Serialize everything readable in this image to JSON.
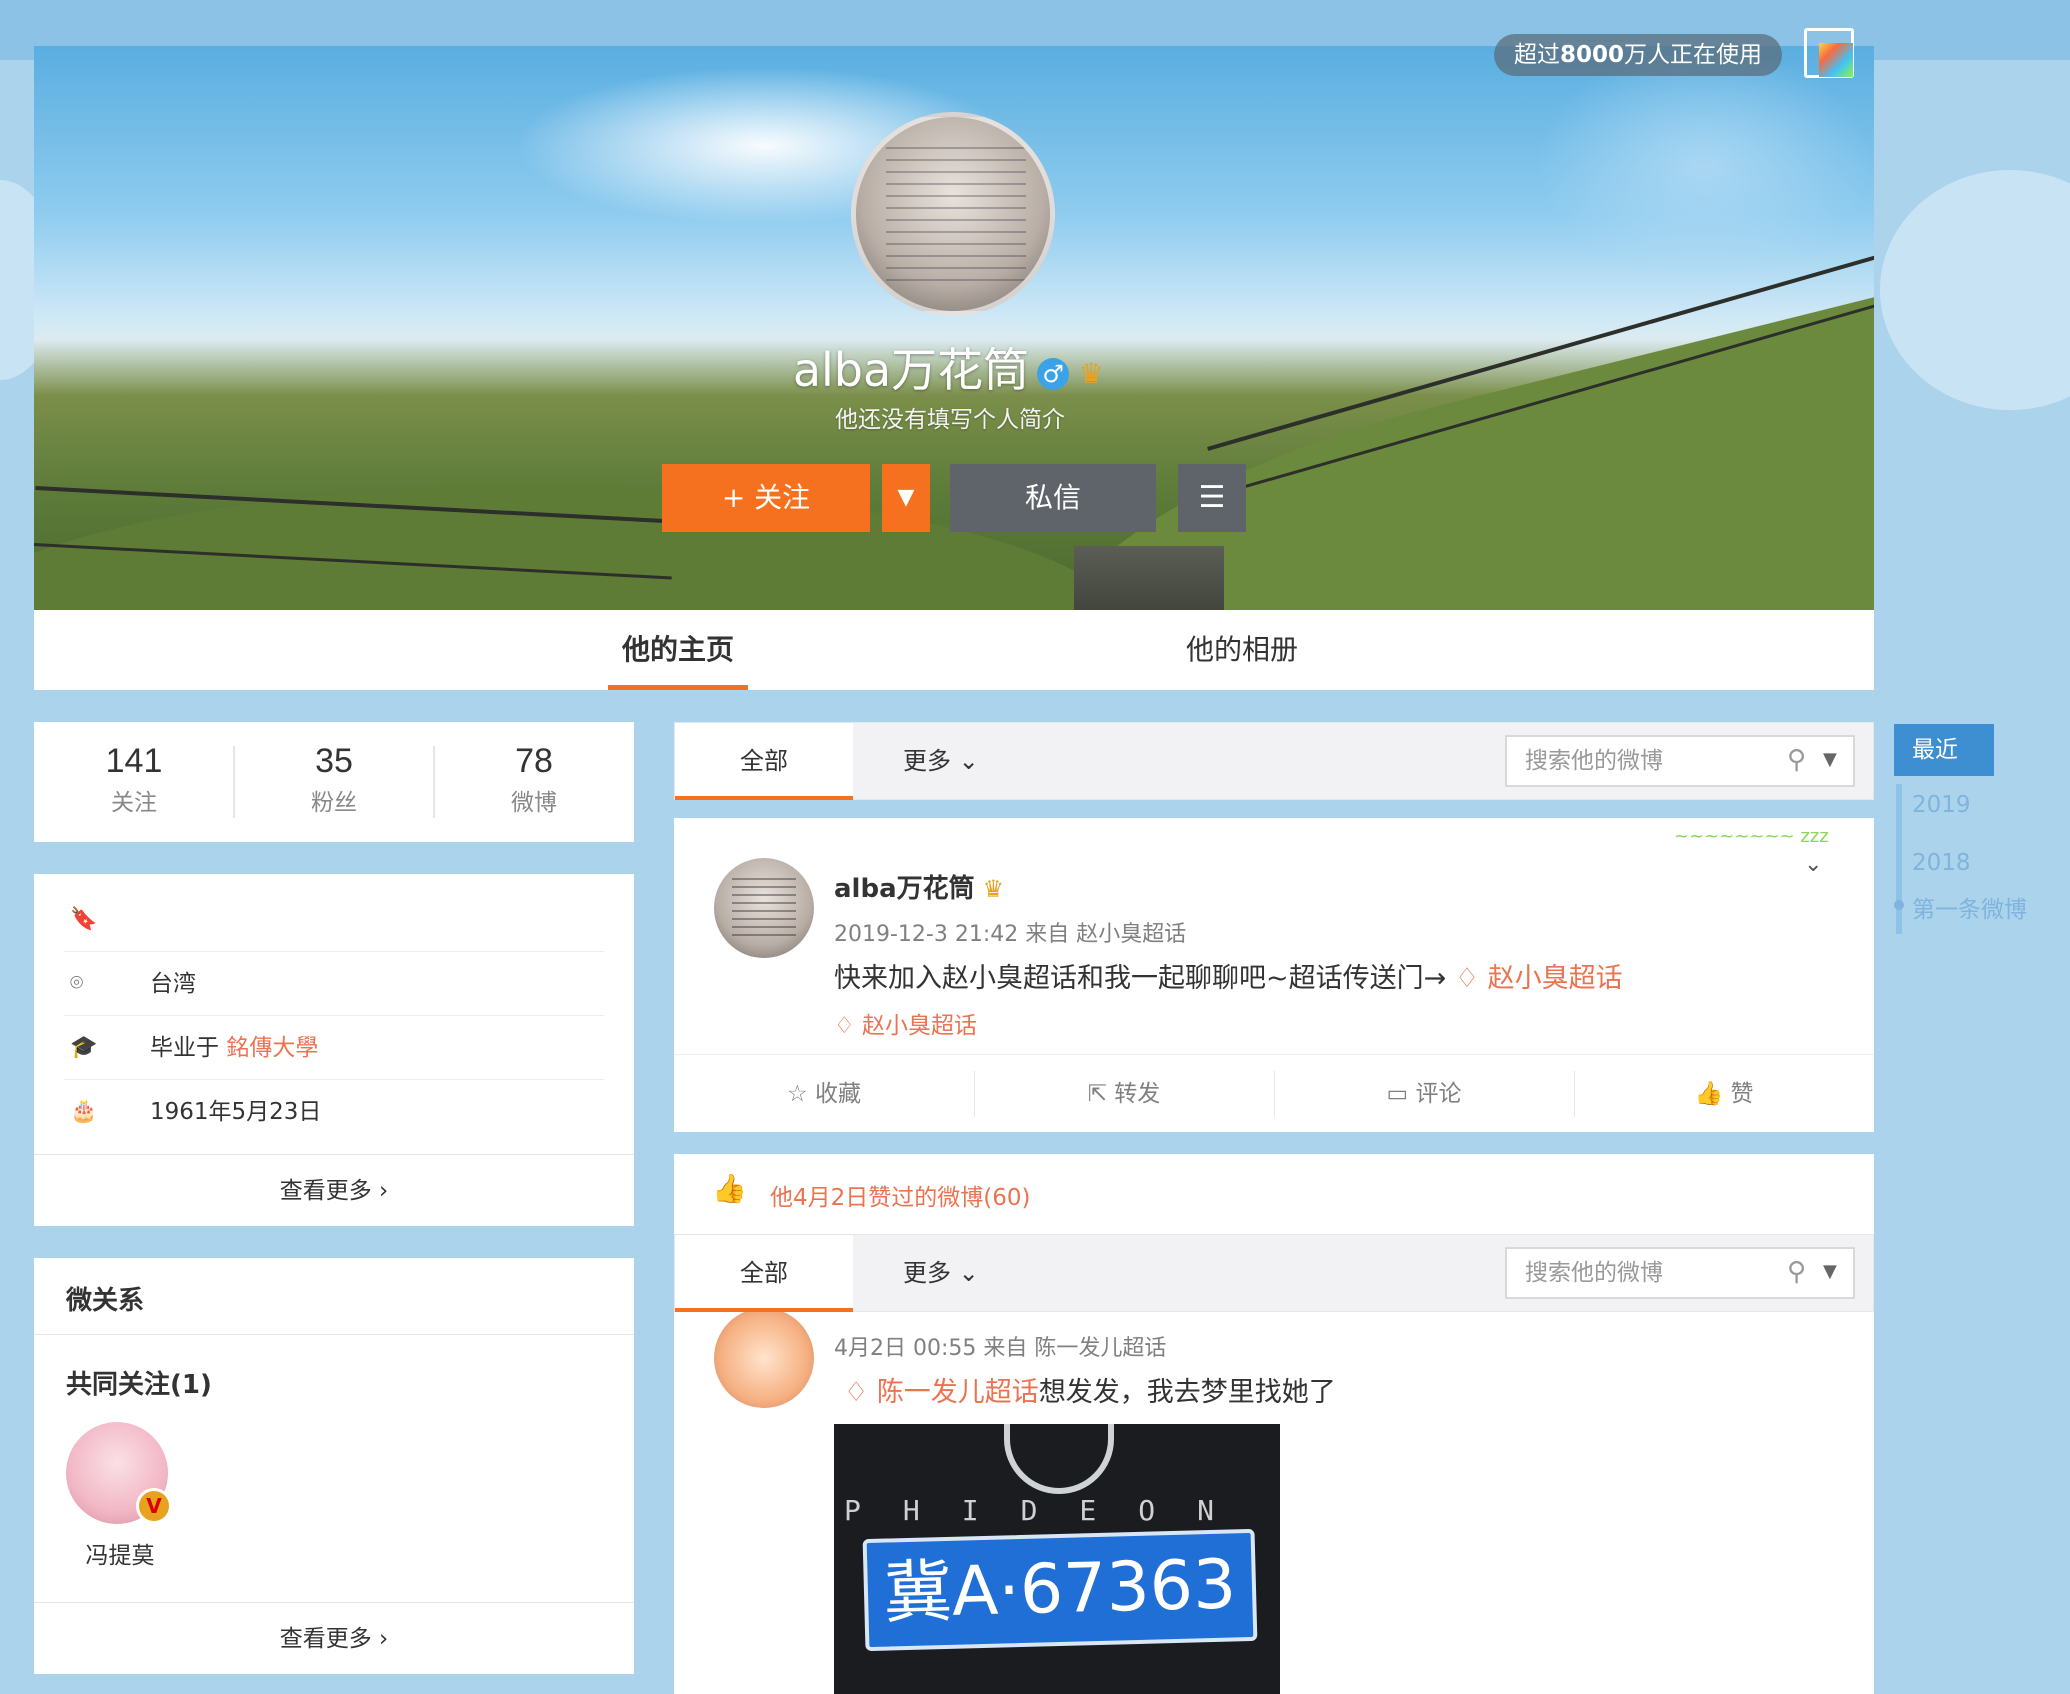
{
  "header": {
    "users_prefix": "超过",
    "users_count": "8000",
    "users_suffix": "万人正在使用"
  },
  "profile": {
    "name": "alba万花筒",
    "gender_icon": "♂",
    "bio": "他还没有填写个人简介",
    "follow_label": "+ 关注",
    "message_label": "私信"
  },
  "tabs": [
    {
      "label": "他的主页",
      "active": true
    },
    {
      "label": "他的相册",
      "active": false
    }
  ],
  "stats": [
    {
      "value": "141",
      "label": "关注"
    },
    {
      "value": "35",
      "label": "粉丝"
    },
    {
      "value": "78",
      "label": "微博"
    }
  ],
  "info": {
    "location": "台湾",
    "education_prefix": "毕业于",
    "education_school": "銘傳大學",
    "birthday": "1961年5月23日",
    "more_label": "查看更多"
  },
  "relations": {
    "title": "微关系",
    "common_label": "共同关注(1)",
    "common_user": "冯提莫",
    "more_label": "查看更多"
  },
  "toolbar": {
    "all_label": "全部",
    "more_label": "更多",
    "search_placeholder": "搜索他的微博"
  },
  "post1": {
    "author": "alba万花筒",
    "meta": "2019-12-3 21:42 来自 赵小臭超话",
    "text": "快来加入赵小臭超话和我一起聊聊吧~超话传送门→",
    "text_tag": "赵小臭超话",
    "tag": "赵小臭超话",
    "actions": [
      "收藏",
      "转发",
      "评论",
      "赞"
    ]
  },
  "liked": {
    "title": "他4月2日赞过的微博(60)",
    "post_meta": "4月2日 00:55 来自 陈一发儿超话",
    "post_tag": "陈一发儿超话",
    "post_text": "想发发，我去梦里找她了",
    "plate_text": "冀A·67363",
    "brand_text": "PHIDEON"
  },
  "timeline": {
    "active": "最近",
    "years": [
      "2019",
      "2018"
    ],
    "first": "第一条微博"
  },
  "colors": {
    "accent_orange": "#f5701f",
    "link_orange": "#eb7350",
    "page_blue": "#abd3ec",
    "timeline_blue": "#3d8fd1"
  }
}
